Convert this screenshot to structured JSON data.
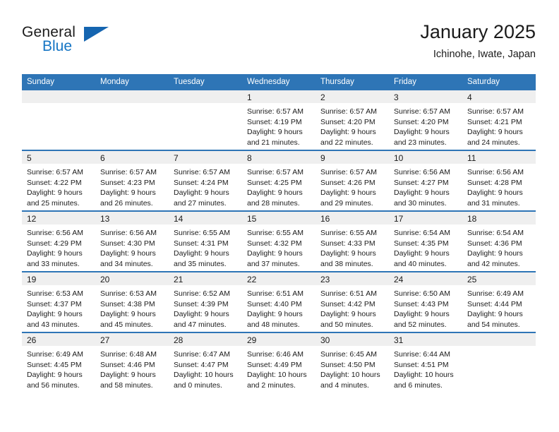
{
  "brand": {
    "name_first": "General",
    "name_second": "Blue",
    "triangle_color": "#1565b0",
    "blue_text_color": "#1575c4"
  },
  "header": {
    "title": "January 2025",
    "location": "Ichinohe, Iwate, Japan"
  },
  "theme": {
    "header_blue": "#2e75b6",
    "daynum_band": "#efefef",
    "text": "#1b1b1b"
  },
  "calendar": {
    "weekday_headers": [
      "Sunday",
      "Monday",
      "Tuesday",
      "Wednesday",
      "Thursday",
      "Friday",
      "Saturday"
    ],
    "weeks": [
      [
        {
          "day": "",
          "lines": []
        },
        {
          "day": "",
          "lines": []
        },
        {
          "day": "",
          "lines": []
        },
        {
          "day": "1",
          "lines": [
            "Sunrise: 6:57 AM",
            "Sunset: 4:19 PM",
            "Daylight: 9 hours",
            "and 21 minutes."
          ]
        },
        {
          "day": "2",
          "lines": [
            "Sunrise: 6:57 AM",
            "Sunset: 4:20 PM",
            "Daylight: 9 hours",
            "and 22 minutes."
          ]
        },
        {
          "day": "3",
          "lines": [
            "Sunrise: 6:57 AM",
            "Sunset: 4:20 PM",
            "Daylight: 9 hours",
            "and 23 minutes."
          ]
        },
        {
          "day": "4",
          "lines": [
            "Sunrise: 6:57 AM",
            "Sunset: 4:21 PM",
            "Daylight: 9 hours",
            "and 24 minutes."
          ]
        }
      ],
      [
        {
          "day": "5",
          "lines": [
            "Sunrise: 6:57 AM",
            "Sunset: 4:22 PM",
            "Daylight: 9 hours",
            "and 25 minutes."
          ]
        },
        {
          "day": "6",
          "lines": [
            "Sunrise: 6:57 AM",
            "Sunset: 4:23 PM",
            "Daylight: 9 hours",
            "and 26 minutes."
          ]
        },
        {
          "day": "7",
          "lines": [
            "Sunrise: 6:57 AM",
            "Sunset: 4:24 PM",
            "Daylight: 9 hours",
            "and 27 minutes."
          ]
        },
        {
          "day": "8",
          "lines": [
            "Sunrise: 6:57 AM",
            "Sunset: 4:25 PM",
            "Daylight: 9 hours",
            "and 28 minutes."
          ]
        },
        {
          "day": "9",
          "lines": [
            "Sunrise: 6:57 AM",
            "Sunset: 4:26 PM",
            "Daylight: 9 hours",
            "and 29 minutes."
          ]
        },
        {
          "day": "10",
          "lines": [
            "Sunrise: 6:56 AM",
            "Sunset: 4:27 PM",
            "Daylight: 9 hours",
            "and 30 minutes."
          ]
        },
        {
          "day": "11",
          "lines": [
            "Sunrise: 6:56 AM",
            "Sunset: 4:28 PM",
            "Daylight: 9 hours",
            "and 31 minutes."
          ]
        }
      ],
      [
        {
          "day": "12",
          "lines": [
            "Sunrise: 6:56 AM",
            "Sunset: 4:29 PM",
            "Daylight: 9 hours",
            "and 33 minutes."
          ]
        },
        {
          "day": "13",
          "lines": [
            "Sunrise: 6:56 AM",
            "Sunset: 4:30 PM",
            "Daylight: 9 hours",
            "and 34 minutes."
          ]
        },
        {
          "day": "14",
          "lines": [
            "Sunrise: 6:55 AM",
            "Sunset: 4:31 PM",
            "Daylight: 9 hours",
            "and 35 minutes."
          ]
        },
        {
          "day": "15",
          "lines": [
            "Sunrise: 6:55 AM",
            "Sunset: 4:32 PM",
            "Daylight: 9 hours",
            "and 37 minutes."
          ]
        },
        {
          "day": "16",
          "lines": [
            "Sunrise: 6:55 AM",
            "Sunset: 4:33 PM",
            "Daylight: 9 hours",
            "and 38 minutes."
          ]
        },
        {
          "day": "17",
          "lines": [
            "Sunrise: 6:54 AM",
            "Sunset: 4:35 PM",
            "Daylight: 9 hours",
            "and 40 minutes."
          ]
        },
        {
          "day": "18",
          "lines": [
            "Sunrise: 6:54 AM",
            "Sunset: 4:36 PM",
            "Daylight: 9 hours",
            "and 42 minutes."
          ]
        }
      ],
      [
        {
          "day": "19",
          "lines": [
            "Sunrise: 6:53 AM",
            "Sunset: 4:37 PM",
            "Daylight: 9 hours",
            "and 43 minutes."
          ]
        },
        {
          "day": "20",
          "lines": [
            "Sunrise: 6:53 AM",
            "Sunset: 4:38 PM",
            "Daylight: 9 hours",
            "and 45 minutes."
          ]
        },
        {
          "day": "21",
          "lines": [
            "Sunrise: 6:52 AM",
            "Sunset: 4:39 PM",
            "Daylight: 9 hours",
            "and 47 minutes."
          ]
        },
        {
          "day": "22",
          "lines": [
            "Sunrise: 6:51 AM",
            "Sunset: 4:40 PM",
            "Daylight: 9 hours",
            "and 48 minutes."
          ]
        },
        {
          "day": "23",
          "lines": [
            "Sunrise: 6:51 AM",
            "Sunset: 4:42 PM",
            "Daylight: 9 hours",
            "and 50 minutes."
          ]
        },
        {
          "day": "24",
          "lines": [
            "Sunrise: 6:50 AM",
            "Sunset: 4:43 PM",
            "Daylight: 9 hours",
            "and 52 minutes."
          ]
        },
        {
          "day": "25",
          "lines": [
            "Sunrise: 6:49 AM",
            "Sunset: 4:44 PM",
            "Daylight: 9 hours",
            "and 54 minutes."
          ]
        }
      ],
      [
        {
          "day": "26",
          "lines": [
            "Sunrise: 6:49 AM",
            "Sunset: 4:45 PM",
            "Daylight: 9 hours",
            "and 56 minutes."
          ]
        },
        {
          "day": "27",
          "lines": [
            "Sunrise: 6:48 AM",
            "Sunset: 4:46 PM",
            "Daylight: 9 hours",
            "and 58 minutes."
          ]
        },
        {
          "day": "28",
          "lines": [
            "Sunrise: 6:47 AM",
            "Sunset: 4:47 PM",
            "Daylight: 10 hours",
            "and 0 minutes."
          ]
        },
        {
          "day": "29",
          "lines": [
            "Sunrise: 6:46 AM",
            "Sunset: 4:49 PM",
            "Daylight: 10 hours",
            "and 2 minutes."
          ]
        },
        {
          "day": "30",
          "lines": [
            "Sunrise: 6:45 AM",
            "Sunset: 4:50 PM",
            "Daylight: 10 hours",
            "and 4 minutes."
          ]
        },
        {
          "day": "31",
          "lines": [
            "Sunrise: 6:44 AM",
            "Sunset: 4:51 PM",
            "Daylight: 10 hours",
            "and 6 minutes."
          ]
        },
        {
          "day": "",
          "lines": []
        }
      ]
    ]
  }
}
